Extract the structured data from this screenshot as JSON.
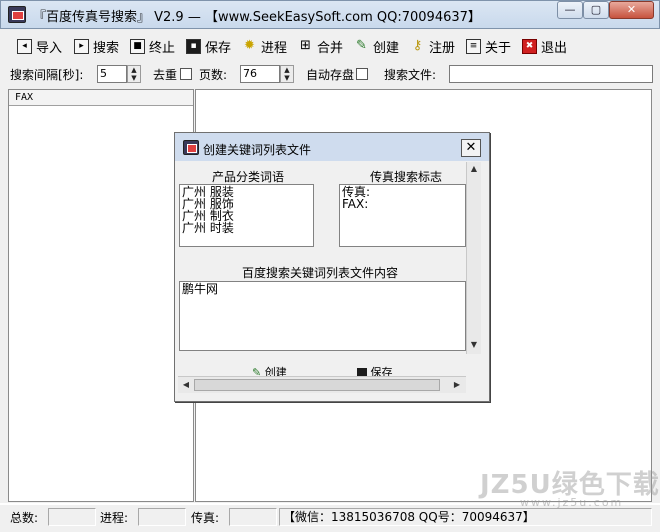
{
  "window": {
    "title": "『百度传真号搜索』 V2.9 — 【www.SeekEasySoft.com QQ:70094637】",
    "minimize_glyph": "—",
    "maximize_glyph": "▢",
    "close_glyph": "✕"
  },
  "toolbar": [
    {
      "label": "导入",
      "icon": "import-icon",
      "glyph": "◂"
    },
    {
      "label": "搜索",
      "icon": "search-play-icon",
      "glyph": "▸"
    },
    {
      "label": "终止",
      "icon": "stop-icon",
      "glyph": "■"
    },
    {
      "label": "保存",
      "icon": "save-icon",
      "glyph": "▪"
    },
    {
      "label": "进程",
      "icon": "lightbulb-icon",
      "glyph": "✹"
    },
    {
      "label": "合并",
      "icon": "merge-icon",
      "glyph": "⊞"
    },
    {
      "label": "创建",
      "icon": "create-icon",
      "glyph": "✎"
    },
    {
      "label": "注册",
      "icon": "key-icon",
      "glyph": "⚷"
    },
    {
      "label": "关于",
      "icon": "about-icon",
      "glyph": "≡"
    },
    {
      "label": "退出",
      "icon": "exit-icon",
      "glyph": "✖"
    }
  ],
  "settings": {
    "interval_label": "搜索间隔[秒]:",
    "interval_value": "5",
    "dedupe_label": "去重",
    "pages_label": "页数:",
    "pages_value": "76",
    "autosave_label": "自动存盘",
    "search_file_label": "搜索文件:",
    "search_file_value": ""
  },
  "left_pane": {
    "header": "FAX"
  },
  "status_bar": {
    "total_label": "总数:",
    "total_value": "",
    "progress_label": "进程:",
    "progress_value": "",
    "fax_label": "传真:",
    "fax_value": "",
    "contact": "【微信：13815036708 QQ号：70094637】"
  },
  "dialog": {
    "title": "创建关键词列表文件",
    "close_glyph": "✕",
    "categories_caption": "产品分类词语",
    "categories": "广州 服装\n广州 服饰\n广州 制衣\n广州 时装",
    "fax_marks_caption": "传真搜索标志",
    "fax_marks": "传真:\nFAX:",
    "content_caption": "百度搜索关键词列表文件内容",
    "content": "鹏牛网",
    "create_button": "创建",
    "save_button": "保存"
  },
  "watermark": {
    "text": "JZ5U绿色下载",
    "url": "www.jz5u.com"
  }
}
